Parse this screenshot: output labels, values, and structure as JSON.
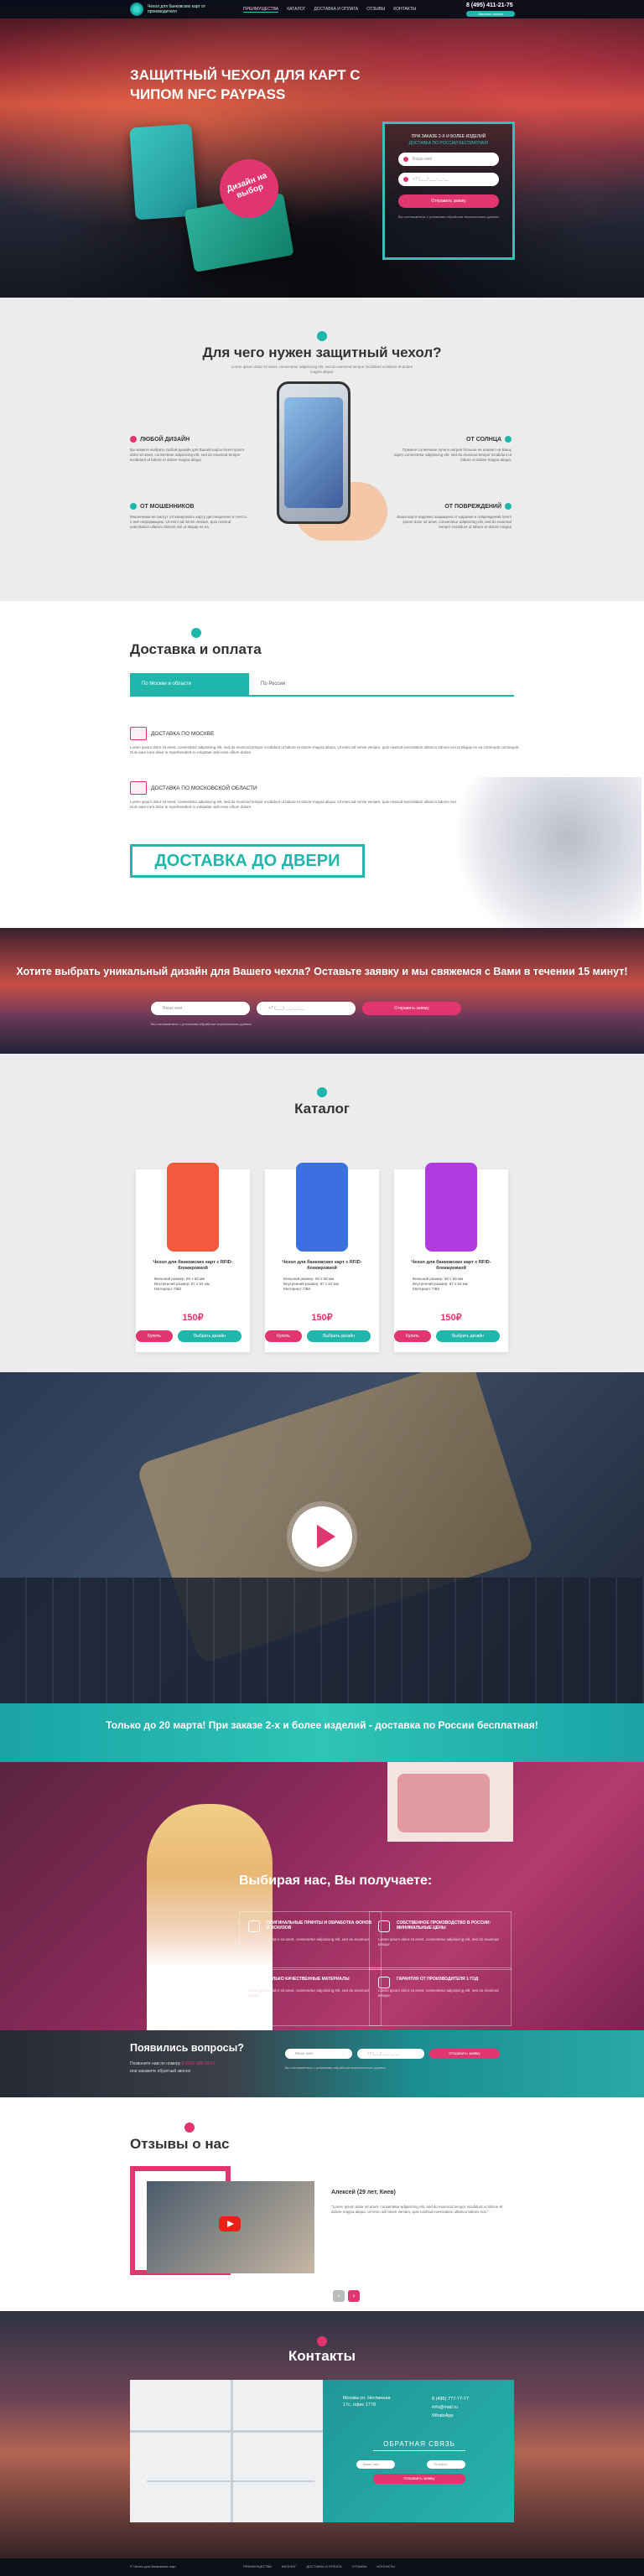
{
  "header": {
    "logo_text": "Чехол для банковских карт от производителя",
    "nav": [
      "Преимущества",
      "Каталог",
      "Доставка и оплата",
      "Отзывы",
      "Контакты"
    ],
    "phone": "8 (495) 411-21-75",
    "callback_label": "Заказать звонок"
  },
  "hero": {
    "title": "Защитный чехол для карт с чипом NFC PayPass",
    "badge": "Дизайн на выбор",
    "form": {
      "line1": "При заказе 2-х и более изделий",
      "line2": "доставка по России бесплатная!",
      "name_placeholder": "Ваше имя",
      "phone_placeholder": "+7 (___) ___-__-__",
      "submit": "Отправить заявку",
      "note": "Вы соглашаетесь с условиями обработки персональных данных"
    }
  },
  "why": {
    "title": "Для чего нужен защитный чехол?",
    "lead": "Lorem ipsum dolor sit amet, consectetur adipisicing elit, sed do eiusmod tempor incididunt ut labore et dolore magna aliqua.",
    "features": [
      {
        "title": "Любой дизайн",
        "text": "Вы можете выбрать любой дизайн для Вашей карты lorem ipsum dolor sit amet, consectetur adipisicing elit, sed do eiusmod tempor incididunt ut labore et dolore magna aliqua."
      },
      {
        "title": "От солнца",
        "text": "Прямые солнечные лучи и нагрев больше не влияют на Вашу карту consectetur adipisicing elit, sed do eiusmod tempor incididunt ut labore et dolore magna aliqua."
      },
      {
        "title": "От мошенников",
        "text": "Мошенники не смогут отсканировать карту дистанционно и счесть с неё информацию. Ut enim ad minim veniam, quis nostrud exercitation ullamco laboris nisi ut aliquip ex ea"
      },
      {
        "title": "От повреждений",
        "text": "Ваша карта надежно защищена от царапин и повреждений lorem ipsum dolor sit amet, consectetur adipisicing elit, sed do eiusmod tempor incididunt ut labore et dolore magna"
      }
    ]
  },
  "delivery": {
    "title": "Доставка и оплата",
    "tabs": [
      "По Москве и области",
      "По России"
    ],
    "items": [
      {
        "title": "Доставка по Москве",
        "text": "Lorem ipsum dolor sit amet, consectetur adipisicing elit, sed do eiusmod tempor incididunt ut labore et dolore magna aliqua. Ut enim ad minim veniam, quis nostrud exercitation ullamco laboris nisi ut aliquip ex ea commodo consequat. Duis aute irure dolor in reprehenderit in voluptate velit esse cillum dolore"
      },
      {
        "title": "Доставка по Московской области",
        "text": "Lorem ipsum dolor sit amet, consectetur adipisicing elit, sed do eiusmod tempor incididunt ut labore et dolore magna aliqua. Ut enim ad minim veniam, quis nostrud exercitation ullamco laboris nisi ut aliquip ex ea commodo consequat. Duis aute irure dolor in reprehenderit in voluptate velit esse cillum dolore"
      }
    ],
    "door": "Доставка до двери"
  },
  "choose": {
    "title": "Хотите выбрать уникальный дизайн для Вашего чехла? Оставьте заявку и мы свяжемся с Вами в течении 15 минут!",
    "name_placeholder": "Ваше имя",
    "phone_placeholder": "+7 (___) ___-__-__",
    "submit": "Отправить заявку",
    "note": "Вы соглашаетесь с условиями обработки персональных данных"
  },
  "catalog": {
    "title": "Каталог",
    "products": [
      {
        "title": "Чехол для банковских карт с RFID-блокировкой",
        "specs": [
          "Внешний размер: 90 х 58 мм",
          "Внутренний размер: 87 х 54 мм",
          "Материал: ПВХ"
        ],
        "price": "150₽",
        "buy": "Купить",
        "design": "Выбрать дизайн",
        "color": "#f15a3c"
      },
      {
        "title": "Чехол для банковских карт с RFID-блокировкой",
        "specs": [
          "Внешний размер: 90 х 58 мм",
          "Внутренний размер: 87 х 54 мм",
          "Материал: ПВХ"
        ],
        "price": "150₽",
        "buy": "Купить",
        "design": "Выбрать дизайн",
        "color": "#3c6fe0"
      },
      {
        "title": "Чехол для банковских карт с RFID-блокировкой",
        "specs": [
          "Внешний размер: 90 х 58 мм",
          "Внутренний размер: 87 х 54 мм",
          "Материал: ПВХ"
        ],
        "price": "150₽",
        "buy": "Купить",
        "design": "Выбрать дизайн",
        "color": "#b03ce0"
      }
    ]
  },
  "promo": {
    "title": "Только до 20 марта! При заказе 2-х и более изделий - доставка по России бесплатная!"
  },
  "benefits": {
    "title": "Выбирая нас, Вы получаете:",
    "items": [
      {
        "title": "Оригинальные принты и обработка фонов и эскизов",
        "text": "Lorem ipsum dolor sit amet, consectetur adipisicing elit, sed do eiusmod tempor"
      },
      {
        "title": "Собственное производство в России: минимальные цены",
        "text": "Lorem ipsum dolor sit amet, consectetur adipisicing elit, sed do eiusmod tempor"
      },
      {
        "title": "Только качественные материалы",
        "text": "Lorem ipsum dolor sit amet, consectetur adipisicing elit, sed do eiusmod tempor"
      },
      {
        "title": "Гарантия от производителя 1 год",
        "text": "Lorem ipsum dolor sit amet, consectetur adipisicing elit, sed do eiusmod tempor"
      }
    ]
  },
  "questions": {
    "title": "Появились вопросы?",
    "line1": "Позвоните нам по номеру",
    "phone": "8 (999) 999-19-12",
    "line2": "или закажите обратный звонок",
    "name_placeholder": "Ваше имя",
    "phone_placeholder": "+7 (___) ___-__-__",
    "submit": "Отправить заявку",
    "note": "Вы соглашаетесь с условиями обработки персональных данных"
  },
  "reviews": {
    "title": "Отзывы о нас",
    "name": "Алексей (29 лет, Киев)",
    "quote": "\"Lorem ipsum dolor sit amet, consectetur adipisicing elit, sed do eiusmod tempor incididunt ut labore et dolore magna aliqua. Ut enim ad minim veniam, quis nostrud exercitation ullamco laboris nisi.\""
  },
  "contacts": {
    "title": "Контакты",
    "address": [
      "Москва ул. Неглинная",
      "17с, офис 1778"
    ],
    "phones": [
      "8 (495) 777-77-77",
      "info@mail.ru",
      "WhatsApp"
    ],
    "form_title": "Обратная связь",
    "name_placeholder": "Ваше имя",
    "phone_placeholder": "Телефон",
    "submit": "Отправить заявку",
    "note": "Вы соглашаетесь с условиями обработки персональных данных"
  },
  "footer": {
    "copy": "© Чехлы для банковских карт",
    "nav": [
      "Преимущества",
      "Каталог",
      "Доставка и оплата",
      "Отзывы",
      "Контакты"
    ]
  },
  "colors": {
    "accent": "#1fb7ac",
    "pink": "#e0356f"
  }
}
